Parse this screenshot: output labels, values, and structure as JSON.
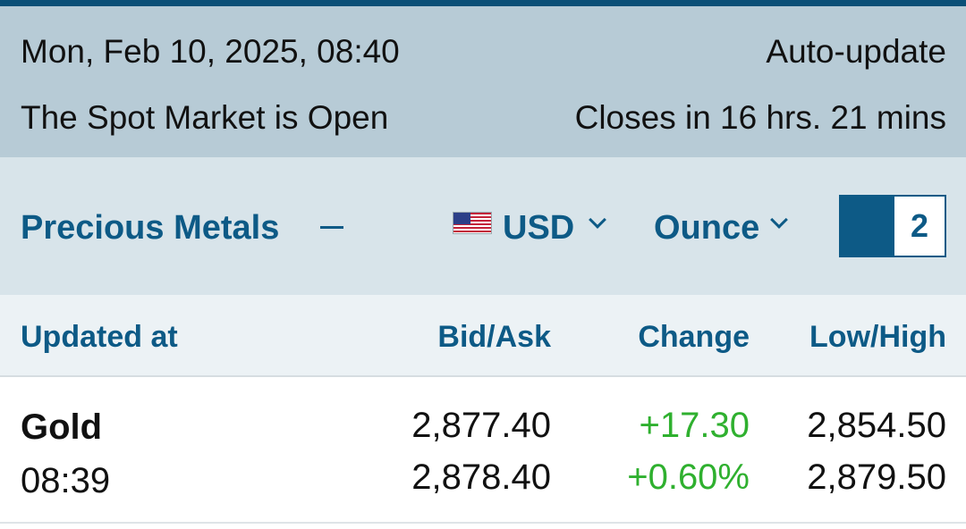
{
  "status": {
    "datetime": "Mon, Feb 10, 2025, 08:40",
    "auto_update": "Auto-update",
    "market_state": "The Spot Market is Open",
    "closes_in": "Closes in 16 hrs. 21 mins"
  },
  "controls": {
    "category": "Precious Metals",
    "category_toggle_icon": "minus-icon",
    "currency_flag_icon": "us-flag-icon",
    "currency": "USD",
    "unit": "Ounce",
    "layout_selected": "1",
    "layout_option": "2"
  },
  "columns": {
    "updated_at": "Updated at",
    "bid_ask": "Bid/Ask",
    "change": "Change",
    "low_high": "Low/High"
  },
  "rows": [
    {
      "metal": "Gold",
      "time": "08:39",
      "bid": "2,877.40",
      "ask": "2,878.40",
      "change": "+17.30",
      "change_pct": "+0.60%",
      "low": "2,854.50",
      "high": "2,879.50"
    }
  ],
  "colors": {
    "accent": "#0d5a86",
    "positive": "#2fb02f",
    "status_bg": "#b7cbd6",
    "controls_bg": "#d8e4ea"
  }
}
